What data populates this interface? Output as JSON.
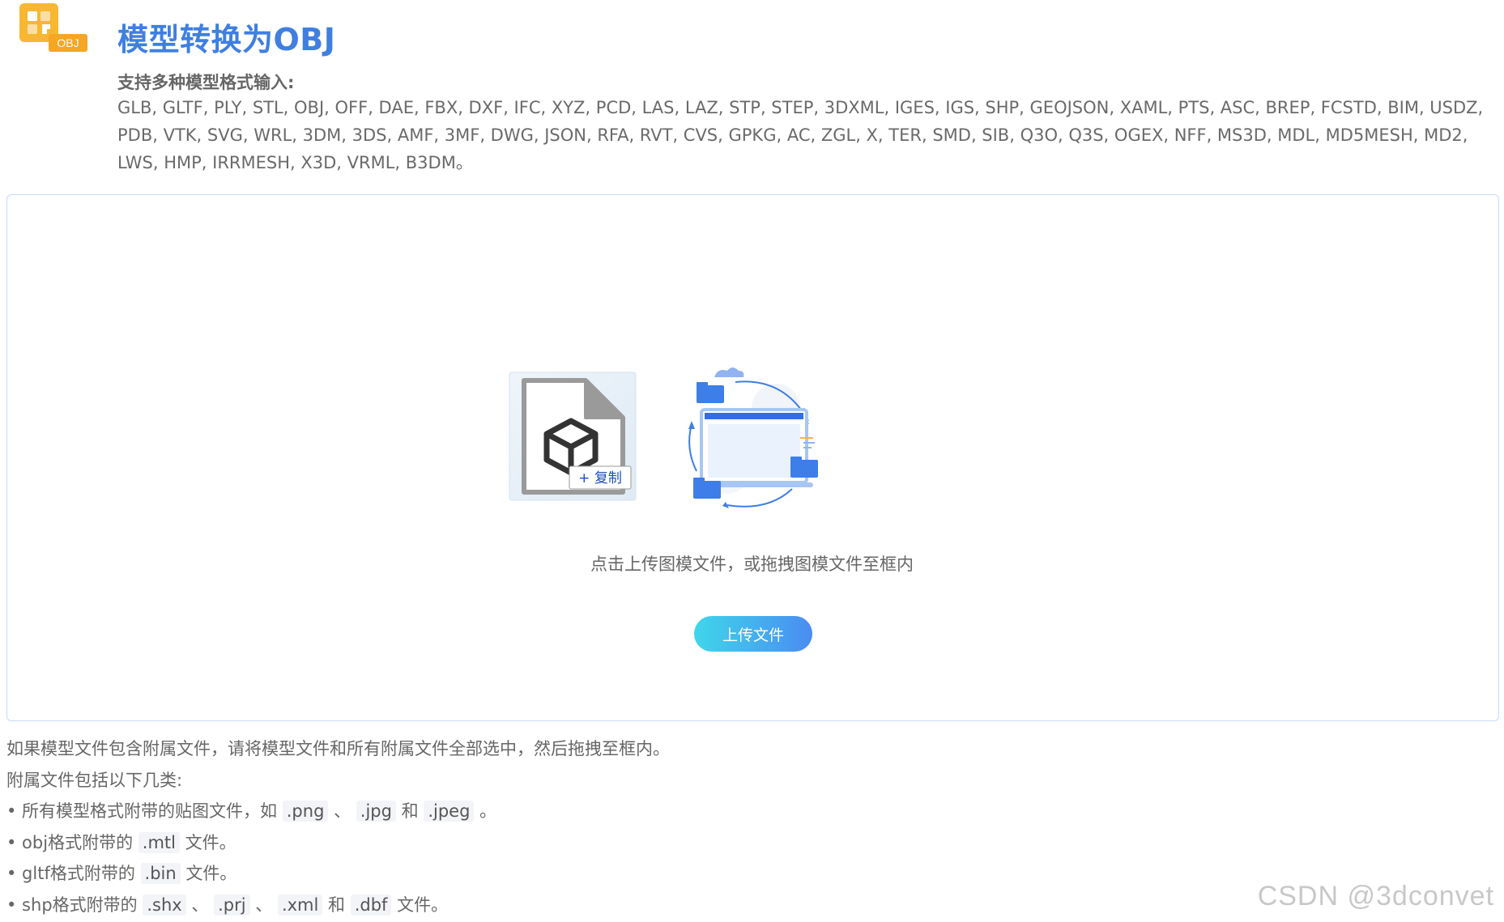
{
  "header": {
    "logo_badge": "OBJ",
    "title": "模型转换为OBJ",
    "support_heading": "支持多种模型格式输入:",
    "formats": "GLB, GLTF, PLY, STL, OBJ, OFF, DAE, FBX, DXF, IFC, XYZ, PCD, LAS, LAZ, STP, STEP, 3DXML, IGES, IGS, SHP, GEOJSON, XAML, PTS, ASC, BREP, FCSTD, BIM, USDZ, PDB, VTK, SVG, WRL, 3DM, 3DS, AMF, 3MF, DWG, JSON, RFA, RVT, CVS, GPKG, AC, ZGL, X, TER, SMD, SIB, Q3O, Q3S, OGEX, NFF, MS3D, MDL, MD5MESH, MD2, LWS, HMP, IRRMESH, X3D, VRML, B3DM。"
  },
  "upload": {
    "copy_badge": "+ 复制",
    "hint": "点击上传图模文件，或拖拽图模文件至框内",
    "button_label": "上传文件"
  },
  "notes": {
    "line1": "如果模型文件包含附属文件，请将模型文件和所有附属文件全部选中，然后拖拽至框内。",
    "line2": "附属文件包括以下几类:",
    "line3": {
      "prefix": "• 所有模型格式附带的贴图文件，如",
      "ext1": ".png",
      "sep1": "、",
      "ext2": ".jpg",
      "sep2": "和",
      "ext3": ".jpeg",
      "suffix": "。"
    },
    "line4": {
      "prefix": "• obj格式附带的",
      "ext1": ".mtl",
      "suffix": "文件。"
    },
    "line5": {
      "prefix": "• gltf格式附带的",
      "ext1": ".bin",
      "suffix": "文件。"
    },
    "line6": {
      "prefix": "• shp格式附带的",
      "ext1": ".shx",
      "sep1": "、",
      "ext2": ".prj",
      "sep2": "、",
      "ext3": ".xml",
      "sep3": "和",
      "ext4": ".dbf",
      "suffix": "文件。"
    }
  },
  "watermark": "CSDN @3dconvet",
  "colors": {
    "title_blue": "#3f7fe0",
    "logo_orange": "#f7b733",
    "button_start": "#3fd6ea",
    "button_end": "#4a8cf2",
    "box_border": "#c9daf5"
  }
}
